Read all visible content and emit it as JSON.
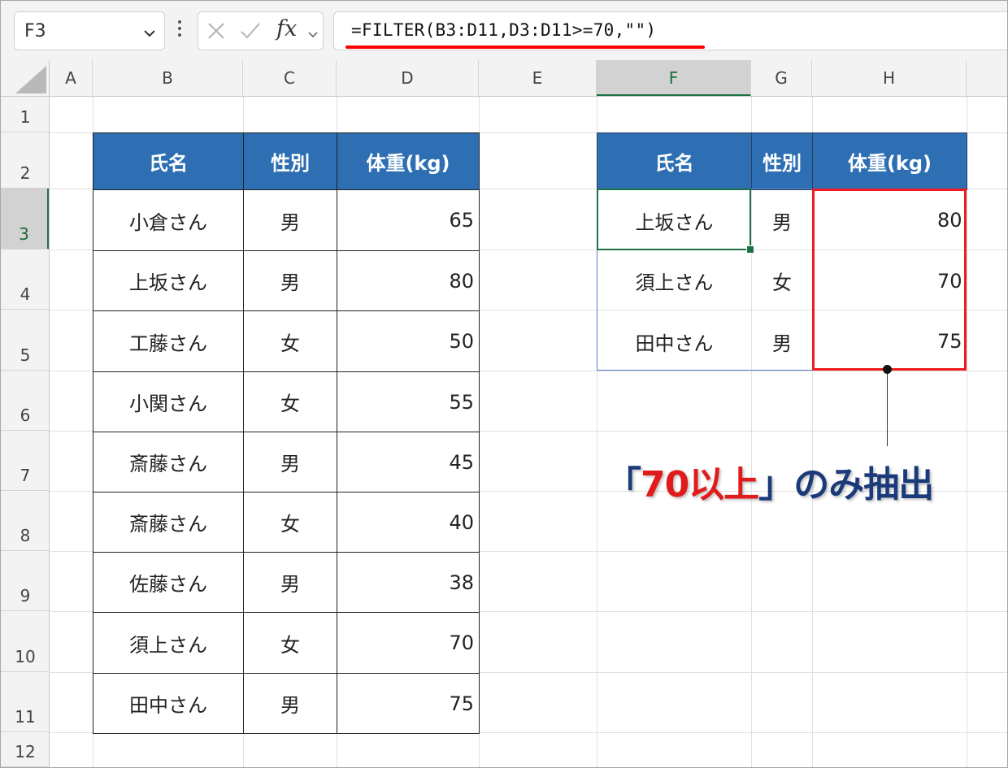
{
  "formula_bar": {
    "name_box": "F3",
    "fx_label": "fx",
    "formula": "=FILTER(B3:D11,D3:D11>=70,\"\")"
  },
  "columns": [
    "A",
    "B",
    "C",
    "D",
    "E",
    "F",
    "G",
    "H"
  ],
  "selected_column": "F",
  "rows": [
    "1",
    "2",
    "3",
    "4",
    "5",
    "6",
    "7",
    "8",
    "9",
    "10",
    "11",
    "12"
  ],
  "selected_row": "3",
  "source_table": {
    "headers": [
      "氏名",
      "性別",
      "体重(kg)"
    ],
    "rows": [
      [
        "小倉さん",
        "男",
        "65"
      ],
      [
        "上坂さん",
        "男",
        "80"
      ],
      [
        "工藤さん",
        "女",
        "50"
      ],
      [
        "小関さん",
        "女",
        "55"
      ],
      [
        "斎藤さん",
        "男",
        "45"
      ],
      [
        "斎藤さん",
        "女",
        "40"
      ],
      [
        "佐藤さん",
        "男",
        "38"
      ],
      [
        "須上さん",
        "女",
        "70"
      ],
      [
        "田中さん",
        "男",
        "75"
      ]
    ]
  },
  "result_table": {
    "headers": [
      "氏名",
      "性別",
      "体重(kg)"
    ],
    "rows": [
      [
        "上坂さん",
        "男",
        "80"
      ],
      [
        "須上さん",
        "女",
        "70"
      ],
      [
        "田中さん",
        "男",
        "75"
      ]
    ]
  },
  "callout": {
    "open_bracket": "「",
    "highlight": "70以上",
    "close_bracket": "」",
    "rest": "のみ抽出"
  },
  "colors": {
    "header_fill": "#2e6fb4",
    "highlight_red": "#ee1c1c",
    "callout_blue": "#1b3a7a",
    "selection_green": "#1e7145"
  }
}
